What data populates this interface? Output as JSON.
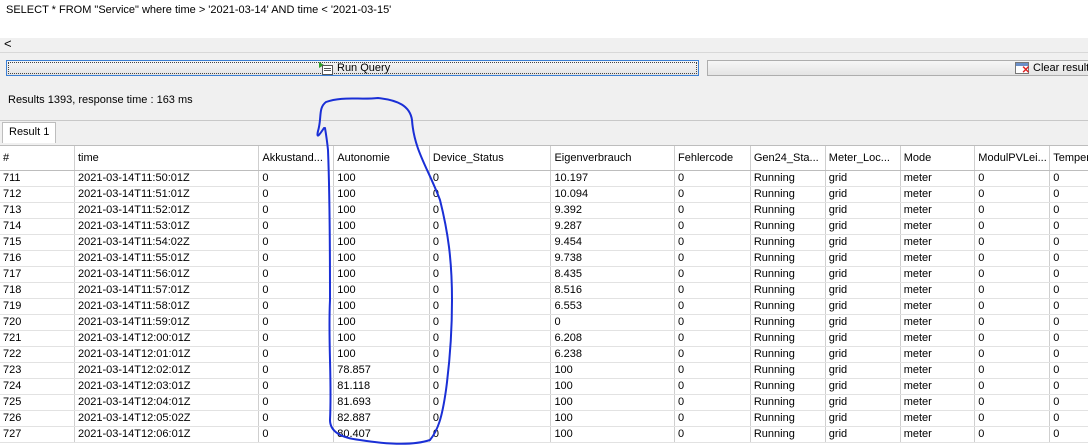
{
  "query": {
    "text": "SELECT * FROM \"Service\" where time > '2021-03-14' AND time < '2021-03-15'"
  },
  "scroll": {
    "left_arrow": "<"
  },
  "toolbar": {
    "run_label": "Run Query",
    "clear_label": "Clear result",
    "run_icon": "run-query-icon",
    "clear_icon": "clear-result-icon"
  },
  "status": {
    "text": "Results 1393, response time : 163 ms"
  },
  "tabs": [
    {
      "label": "Result 1"
    }
  ],
  "table": {
    "columns": [
      "#",
      "time",
      "Akkustand...",
      "Autonomie",
      "Device_Status",
      "Eigenverbrauch",
      "Fehlercode",
      "Gen24_Sta...",
      "Meter_Loc...",
      "Mode",
      "ModulPVLei...",
      "Temperatur"
    ],
    "rows": [
      [
        "711",
        "2021-03-14T11:50:01Z",
        "0",
        "100",
        "0",
        "10.197",
        "0",
        "Running",
        "grid",
        "meter",
        "0",
        "0"
      ],
      [
        "712",
        "2021-03-14T11:51:01Z",
        "0",
        "100",
        "0",
        "10.094",
        "0",
        "Running",
        "grid",
        "meter",
        "0",
        "0"
      ],
      [
        "713",
        "2021-03-14T11:52:01Z",
        "0",
        "100",
        "0",
        "9.392",
        "0",
        "Running",
        "grid",
        "meter",
        "0",
        "0"
      ],
      [
        "714",
        "2021-03-14T11:53:01Z",
        "0",
        "100",
        "0",
        "9.287",
        "0",
        "Running",
        "grid",
        "meter",
        "0",
        "0"
      ],
      [
        "715",
        "2021-03-14T11:54:02Z",
        "0",
        "100",
        "0",
        "9.454",
        "0",
        "Running",
        "grid",
        "meter",
        "0",
        "0"
      ],
      [
        "716",
        "2021-03-14T11:55:01Z",
        "0",
        "100",
        "0",
        "9.738",
        "0",
        "Running",
        "grid",
        "meter",
        "0",
        "0"
      ],
      [
        "717",
        "2021-03-14T11:56:01Z",
        "0",
        "100",
        "0",
        "8.435",
        "0",
        "Running",
        "grid",
        "meter",
        "0",
        "0"
      ],
      [
        "718",
        "2021-03-14T11:57:01Z",
        "0",
        "100",
        "0",
        "8.516",
        "0",
        "Running",
        "grid",
        "meter",
        "0",
        "0"
      ],
      [
        "719",
        "2021-03-14T11:58:01Z",
        "0",
        "100",
        "0",
        "6.553",
        "0",
        "Running",
        "grid",
        "meter",
        "0",
        "0"
      ],
      [
        "720",
        "2021-03-14T11:59:01Z",
        "0",
        "100",
        "0",
        "0",
        "0",
        "Running",
        "grid",
        "meter",
        "0",
        "0"
      ],
      [
        "721",
        "2021-03-14T12:00:01Z",
        "0",
        "100",
        "0",
        "6.208",
        "0",
        "Running",
        "grid",
        "meter",
        "0",
        "0"
      ],
      [
        "722",
        "2021-03-14T12:01:01Z",
        "0",
        "100",
        "0",
        "6.238",
        "0",
        "Running",
        "grid",
        "meter",
        "0",
        "0"
      ],
      [
        "723",
        "2021-03-14T12:02:01Z",
        "0",
        "78.857",
        "0",
        "100",
        "0",
        "Running",
        "grid",
        "meter",
        "0",
        "0"
      ],
      [
        "724",
        "2021-03-14T12:03:01Z",
        "0",
        "81.118",
        "0",
        "100",
        "0",
        "Running",
        "grid",
        "meter",
        "0",
        "0"
      ],
      [
        "725",
        "2021-03-14T12:04:01Z",
        "0",
        "81.693",
        "0",
        "100",
        "0",
        "Running",
        "grid",
        "meter",
        "0",
        "0"
      ],
      [
        "726",
        "2021-03-14T12:05:02Z",
        "0",
        "82.887",
        "0",
        "100",
        "0",
        "Running",
        "grid",
        "meter",
        "0",
        "0"
      ],
      [
        "727",
        "2021-03-14T12:06:01Z",
        "0",
        "80.407",
        "0",
        "100",
        "0",
        "Running",
        "grid",
        "meter",
        "0",
        "0"
      ]
    ]
  },
  "annotation": {
    "color": "#1a2fd6"
  }
}
